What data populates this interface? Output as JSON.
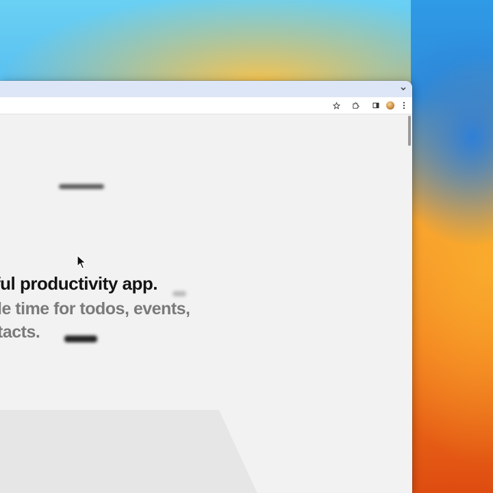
{
  "browser": {
    "tab_list_icon": "chevron-down-icon",
    "toolbar_icons": [
      "bookmark-star-icon",
      "extensions-puzzle-icon",
      "side-panel-icon",
      "profile-avatar",
      "more-menu-icon"
    ]
  },
  "page": {
    "hero": {
      "headline": "ful productivity app.",
      "subline_1": "le time for todos, events,",
      "subline_2": "tacts."
    }
  },
  "colors": {
    "headline": "#141414",
    "subline": "#7a7a7a",
    "page_background": "#f2f2f2",
    "titlebar": "#dde6f6"
  }
}
